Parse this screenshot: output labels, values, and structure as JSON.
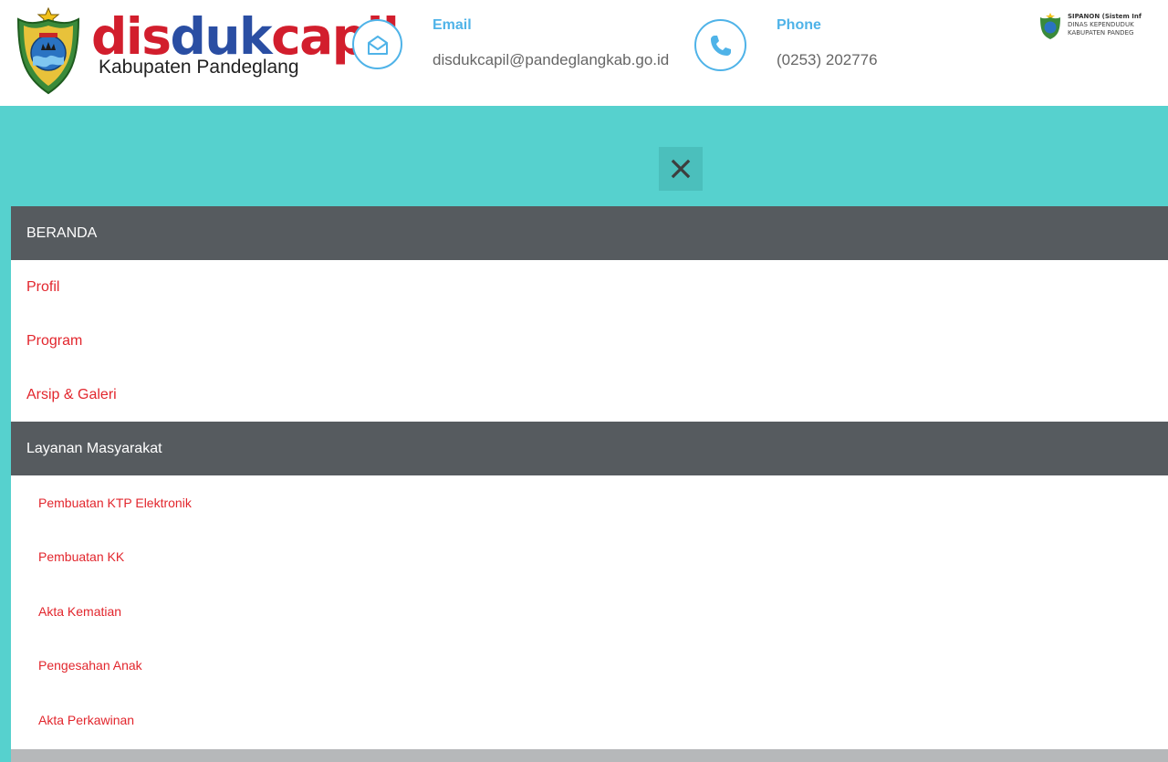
{
  "logo": {
    "word_red_1": "dis",
    "word_blue": "duk",
    "word_red_2": "capil",
    "subtitle": "Kabupaten Pandeglang"
  },
  "contacts": [
    {
      "title": "Email",
      "value": "disdukcapil@pandeglangkab.go.id",
      "icon": "envelope-icon"
    },
    {
      "title": "Phone",
      "value": "(0253) 202776",
      "icon": "phone-icon"
    }
  ],
  "banner": {
    "line1": "SIPANON (Sistem Inf",
    "line2": "DINAS KEPENDUDUK",
    "line3": "KABUPATEN PANDEG"
  },
  "close_icon": "close-icon",
  "menu": {
    "items": [
      {
        "label": "BERANDA",
        "kind": "head"
      },
      {
        "label": "Profil",
        "kind": "link"
      },
      {
        "label": "Program",
        "kind": "link"
      },
      {
        "label": "Arsip & Galeri",
        "kind": "link"
      },
      {
        "label": "Layanan Masyarakat",
        "kind": "head"
      },
      {
        "label": "Pembuatan KTP Elektronik",
        "kind": "sub"
      },
      {
        "label": "Pembuatan KK",
        "kind": "sub"
      },
      {
        "label": "Akta Kematian",
        "kind": "sub"
      },
      {
        "label": "Pengesahan Anak",
        "kind": "sub"
      },
      {
        "label": "Akta Perkawinan",
        "kind": "sub"
      }
    ]
  },
  "colors": {
    "teal": "#56d1ce",
    "menu_header": "#565b5f",
    "link_red": "#e2262d",
    "accent_blue": "#4fb3e8",
    "logo_red": "#d21e2d",
    "logo_blue": "#2a4ea3"
  }
}
